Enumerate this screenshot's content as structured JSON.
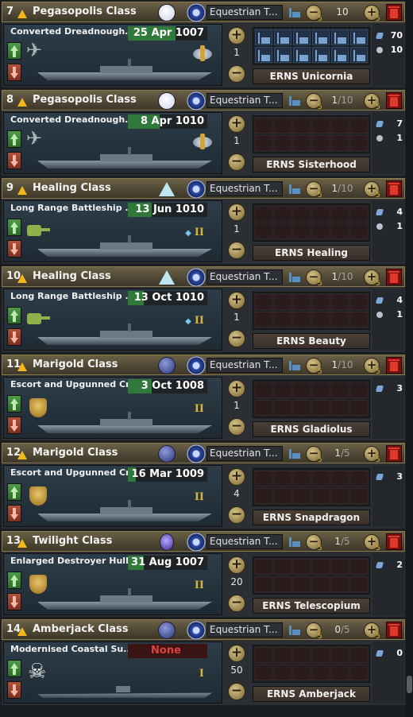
{
  "colors": {
    "header_bg": "#4d4634",
    "progress_green": "#2f7a3a",
    "delete_red": "#7a1010",
    "none_red": "#e04040"
  },
  "queue": [
    {
      "index": "7",
      "class_name": "Pegasopolis Class",
      "emblem": "white-orb-emblem",
      "owner": "Equestrian T...",
      "runs": "10",
      "runs_total": "",
      "variant": "Converted Dreadnough...",
      "date": "25 Apr 1007",
      "progress": 0.6,
      "module_icon": "plane",
      "badge": "wing",
      "tier": "",
      "count": "1",
      "ship_name": "ERNS Unicornia",
      "dockyards_on": 12,
      "stat1": "70",
      "stat2": "10",
      "ship_type": "carrier"
    },
    {
      "index": "8",
      "class_name": "Pegasopolis Class",
      "emblem": "white-orb-emblem",
      "owner": "Equestrian T...",
      "runs": "1",
      "runs_total": "/10",
      "variant": "Converted Dreadnough...",
      "date": "8 Apr 1010",
      "progress": 0.4,
      "module_icon": "plane",
      "badge": "wing",
      "tier": "",
      "count": "1",
      "ship_name": "ERNS Sisterhood",
      "dockyards_on": 0,
      "stat1": "7",
      "stat2": "1",
      "ship_type": "carrier"
    },
    {
      "index": "9",
      "class_name": "Healing Class",
      "emblem": "crystal-emblem",
      "owner": "Equestrian T...",
      "runs": "1",
      "runs_total": "/10",
      "variant": "Long Range Battleship ...",
      "date": "13 Jun 1010",
      "progress": 0.3,
      "module_icon": "gun",
      "badge": "",
      "tier": "II",
      "count": "1",
      "ship_name": "ERNS Healing",
      "dockyards_on": 0,
      "stat1": "4",
      "stat2": "1",
      "ship_type": "battleship"
    },
    {
      "index": "10",
      "class_name": "Healing Class",
      "emblem": "crystal-emblem",
      "owner": "Equestrian T...",
      "runs": "1",
      "runs_total": "/10",
      "variant": "Long Range Battleship ...",
      "date": "13 Oct 1010",
      "progress": 0.2,
      "module_icon": "gun",
      "badge": "",
      "tier": "II",
      "count": "1",
      "ship_name": "ERNS Beauty",
      "dockyards_on": 0,
      "stat1": "4",
      "stat2": "1",
      "ship_type": "battleship"
    },
    {
      "index": "11",
      "class_name": "Marigold Class",
      "emblem": "moon-emblem",
      "owner": "Equestrian T...",
      "runs": "1",
      "runs_total": "/10",
      "variant": "Escort and Upgunned Cr...",
      "date": "3 Oct 1008",
      "progress": 0.3,
      "module_icon": "shield",
      "badge": "",
      "tier": "II",
      "count": "1",
      "ship_name": "ERNS Gladiolus",
      "dockyards_on": 0,
      "stat1": "3",
      "stat2": "",
      "ship_type": "cruiser"
    },
    {
      "index": "12",
      "class_name": "Marigold Class",
      "emblem": "moon-emblem",
      "owner": "Equestrian T...",
      "runs": "1",
      "runs_total": "/5",
      "variant": "Escort and Upgunned Cr...",
      "date": "16 Mar 1009",
      "progress": 0.1,
      "module_icon": "shield",
      "badge": "",
      "tier": "II",
      "count": "4",
      "ship_name": "ERNS Snapdragon",
      "dockyards_on": 0,
      "stat1": "3",
      "stat2": "",
      "ship_type": "cruiser"
    },
    {
      "index": "13",
      "class_name": "Twilight Class",
      "emblem": "star-emblem",
      "owner": "Equestrian T...",
      "runs": "1",
      "runs_total": "/5",
      "variant": "Enlarged Destroyer Hull",
      "date": "31 Aug 1007",
      "progress": 0.2,
      "module_icon": "shield",
      "badge": "",
      "tier": "II",
      "count": "20",
      "ship_name": "ERNS Telescopium",
      "dockyards_on": 0,
      "stat1": "2",
      "stat2": "",
      "ship_type": "destroyer"
    },
    {
      "index": "14",
      "class_name": "Amberjack Class",
      "emblem": "moon-emblem",
      "owner": "Equestrian T...",
      "runs": "0",
      "runs_total": "/5",
      "variant": "Modernised Coastal Su...",
      "date": "None",
      "progress": 0,
      "module_icon": "skull",
      "badge": "",
      "tier": "I",
      "count": "50",
      "ship_name": "ERNS Amberjack",
      "dockyards_on": 0,
      "stat1": "0",
      "stat2": "",
      "ship_type": "submarine"
    }
  ]
}
